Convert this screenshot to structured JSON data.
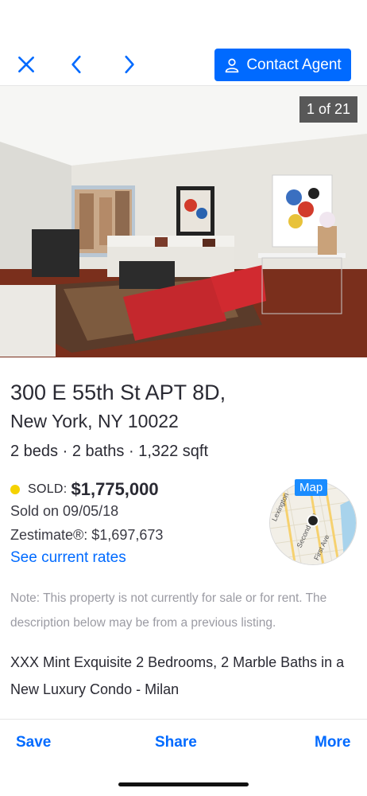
{
  "header": {
    "contact_label": "Contact Agent",
    "accent": "#006aff"
  },
  "photo": {
    "counter": "1 of 21"
  },
  "listing": {
    "address_line1": "300 E 55th St APT 8D,",
    "address_line2": "New York, NY 10022",
    "facts": "2 beds · 2 baths · 1,322 sqft",
    "status_label": "SOLD:",
    "status_color": "#f5d200",
    "price": "$1,775,000",
    "sold_date": "Sold on 09/05/18",
    "zestimate": "Zestimate®: $1,697,673",
    "rates_link": "See current rates",
    "note": "Note: This property is not currently for sale or for rent. The description below may be from a previous listing.",
    "description": "XXX Mint Exquisite 2 Bedrooms, 2 Marble Baths in a New Luxury Condo - Milan"
  },
  "map": {
    "badge": "Map",
    "streets": [
      "Lexington",
      "Second Ave",
      "First Ave"
    ]
  },
  "actions": {
    "save": "Save",
    "share": "Share",
    "more": "More"
  },
  "icons": [
    "close-icon",
    "chevron-left-icon",
    "chevron-right-icon",
    "user-icon"
  ]
}
